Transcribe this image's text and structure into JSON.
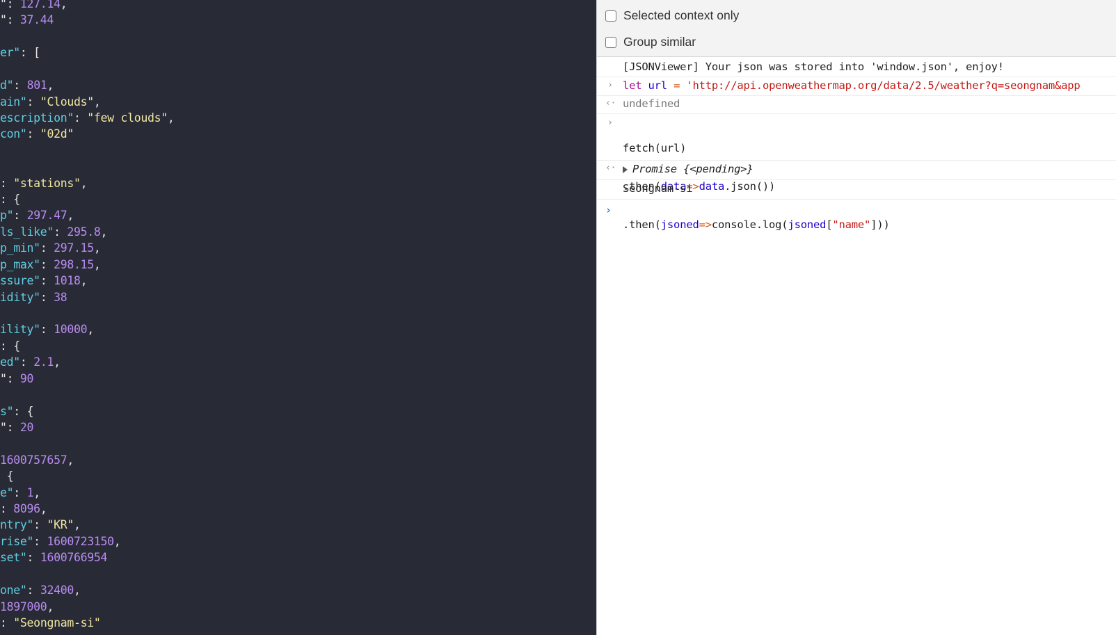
{
  "json_viewer": {
    "lines": [
      [
        {
          "t": "p",
          "v": "\": "
        },
        {
          "t": "n",
          "v": "127.14"
        },
        {
          "t": "p",
          "v": ","
        }
      ],
      [
        {
          "t": "p",
          "v": "\": "
        },
        {
          "t": "n",
          "v": "37.44"
        }
      ],
      [],
      [
        {
          "t": "k",
          "v": "er\""
        },
        {
          "t": "p",
          "v": ": ["
        }
      ],
      [],
      [
        {
          "t": "k",
          "v": "d\""
        },
        {
          "t": "p",
          "v": ": "
        },
        {
          "t": "n",
          "v": "801"
        },
        {
          "t": "p",
          "v": ","
        }
      ],
      [
        {
          "t": "k",
          "v": "ain\""
        },
        {
          "t": "p",
          "v": ": "
        },
        {
          "t": "s",
          "v": "\"Clouds\""
        },
        {
          "t": "p",
          "v": ","
        }
      ],
      [
        {
          "t": "k",
          "v": "escription\""
        },
        {
          "t": "p",
          "v": ": "
        },
        {
          "t": "s",
          "v": "\"few clouds\""
        },
        {
          "t": "p",
          "v": ","
        }
      ],
      [
        {
          "t": "k",
          "v": "con\""
        },
        {
          "t": "p",
          "v": ": "
        },
        {
          "t": "s",
          "v": "\"02d\""
        }
      ],
      [],
      [],
      [
        {
          "t": "p",
          "v": ": "
        },
        {
          "t": "s",
          "v": "\"stations\""
        },
        {
          "t": "p",
          "v": ","
        }
      ],
      [
        {
          "t": "p",
          "v": ": {"
        }
      ],
      [
        {
          "t": "k",
          "v": "p\""
        },
        {
          "t": "p",
          "v": ": "
        },
        {
          "t": "n",
          "v": "297.47"
        },
        {
          "t": "p",
          "v": ","
        }
      ],
      [
        {
          "t": "k",
          "v": "ls_like\""
        },
        {
          "t": "p",
          "v": ": "
        },
        {
          "t": "n",
          "v": "295.8"
        },
        {
          "t": "p",
          "v": ","
        }
      ],
      [
        {
          "t": "k",
          "v": "p_min\""
        },
        {
          "t": "p",
          "v": ": "
        },
        {
          "t": "n",
          "v": "297.15"
        },
        {
          "t": "p",
          "v": ","
        }
      ],
      [
        {
          "t": "k",
          "v": "p_max\""
        },
        {
          "t": "p",
          "v": ": "
        },
        {
          "t": "n",
          "v": "298.15"
        },
        {
          "t": "p",
          "v": ","
        }
      ],
      [
        {
          "t": "k",
          "v": "ssure\""
        },
        {
          "t": "p",
          "v": ": "
        },
        {
          "t": "n",
          "v": "1018"
        },
        {
          "t": "p",
          "v": ","
        }
      ],
      [
        {
          "t": "k",
          "v": "idity\""
        },
        {
          "t": "p",
          "v": ": "
        },
        {
          "t": "n",
          "v": "38"
        }
      ],
      [],
      [
        {
          "t": "k",
          "v": "ility\""
        },
        {
          "t": "p",
          "v": ": "
        },
        {
          "t": "n",
          "v": "10000"
        },
        {
          "t": "p",
          "v": ","
        }
      ],
      [
        {
          "t": "p",
          "v": ": {"
        }
      ],
      [
        {
          "t": "k",
          "v": "ed\""
        },
        {
          "t": "p",
          "v": ": "
        },
        {
          "t": "n",
          "v": "2.1"
        },
        {
          "t": "p",
          "v": ","
        }
      ],
      [
        {
          "t": "p",
          "v": "\": "
        },
        {
          "t": "n",
          "v": "90"
        }
      ],
      [],
      [
        {
          "t": "k",
          "v": "s\""
        },
        {
          "t": "p",
          "v": ": {"
        }
      ],
      [
        {
          "t": "p",
          "v": "\": "
        },
        {
          "t": "n",
          "v": "20"
        }
      ],
      [],
      [
        {
          "t": "n",
          "v": "1600757657"
        },
        {
          "t": "p",
          "v": ","
        }
      ],
      [
        {
          "t": "p",
          "v": " {"
        }
      ],
      [
        {
          "t": "k",
          "v": "e\""
        },
        {
          "t": "p",
          "v": ": "
        },
        {
          "t": "n",
          "v": "1"
        },
        {
          "t": "p",
          "v": ","
        }
      ],
      [
        {
          "t": "p",
          "v": ": "
        },
        {
          "t": "n",
          "v": "8096"
        },
        {
          "t": "p",
          "v": ","
        }
      ],
      [
        {
          "t": "k",
          "v": "ntry\""
        },
        {
          "t": "p",
          "v": ": "
        },
        {
          "t": "s",
          "v": "\"KR\""
        },
        {
          "t": "p",
          "v": ","
        }
      ],
      [
        {
          "t": "k",
          "v": "rise\""
        },
        {
          "t": "p",
          "v": ": "
        },
        {
          "t": "n",
          "v": "1600723150"
        },
        {
          "t": "p",
          "v": ","
        }
      ],
      [
        {
          "t": "k",
          "v": "set\""
        },
        {
          "t": "p",
          "v": ": "
        },
        {
          "t": "n",
          "v": "1600766954"
        }
      ],
      [],
      [
        {
          "t": "k",
          "v": "one\""
        },
        {
          "t": "p",
          "v": ": "
        },
        {
          "t": "n",
          "v": "32400"
        },
        {
          "t": "p",
          "v": ","
        }
      ],
      [
        {
          "t": "n",
          "v": "1897000"
        },
        {
          "t": "p",
          "v": ","
        }
      ],
      [
        {
          "t": "p",
          "v": ": "
        },
        {
          "t": "s",
          "v": "\"Seongnam-si\""
        }
      ]
    ]
  },
  "console": {
    "settings": {
      "selected_context_only": "Selected context only",
      "group_similar": "Group similar"
    },
    "messages": {
      "jsonviewer_info": "[JSONViewer] Your json was stored into 'window.json', enjoy!",
      "input1": {
        "kw": "let",
        "var": "url",
        "op": " = ",
        "str": "'http://api.openweathermap.org/data/2.5/weather?q=seongnam&app"
      },
      "output1": "undefined",
      "input2": {
        "l1": "fetch(url)",
        "l2_a": ".then(",
        "l2_b": "data",
        "l2_c": "=>",
        "l2_d": "data",
        "l2_e": ".json())",
        "l3_a": ".then(",
        "l3_b": "jsoned",
        "l3_c": "=>",
        "l3_d": "console.log(",
        "l3_e": "jsoned",
        "l3_f": "[",
        "l3_g": "\"name\"",
        "l3_h": "]))"
      },
      "output2": {
        "label": "Promise",
        "value": "{<pending>}"
      },
      "log": "Seongnam-si"
    },
    "glyphs": {
      "input_chevron": "›",
      "output_arrow": "‹·",
      "prompt_chevron": "›"
    }
  }
}
